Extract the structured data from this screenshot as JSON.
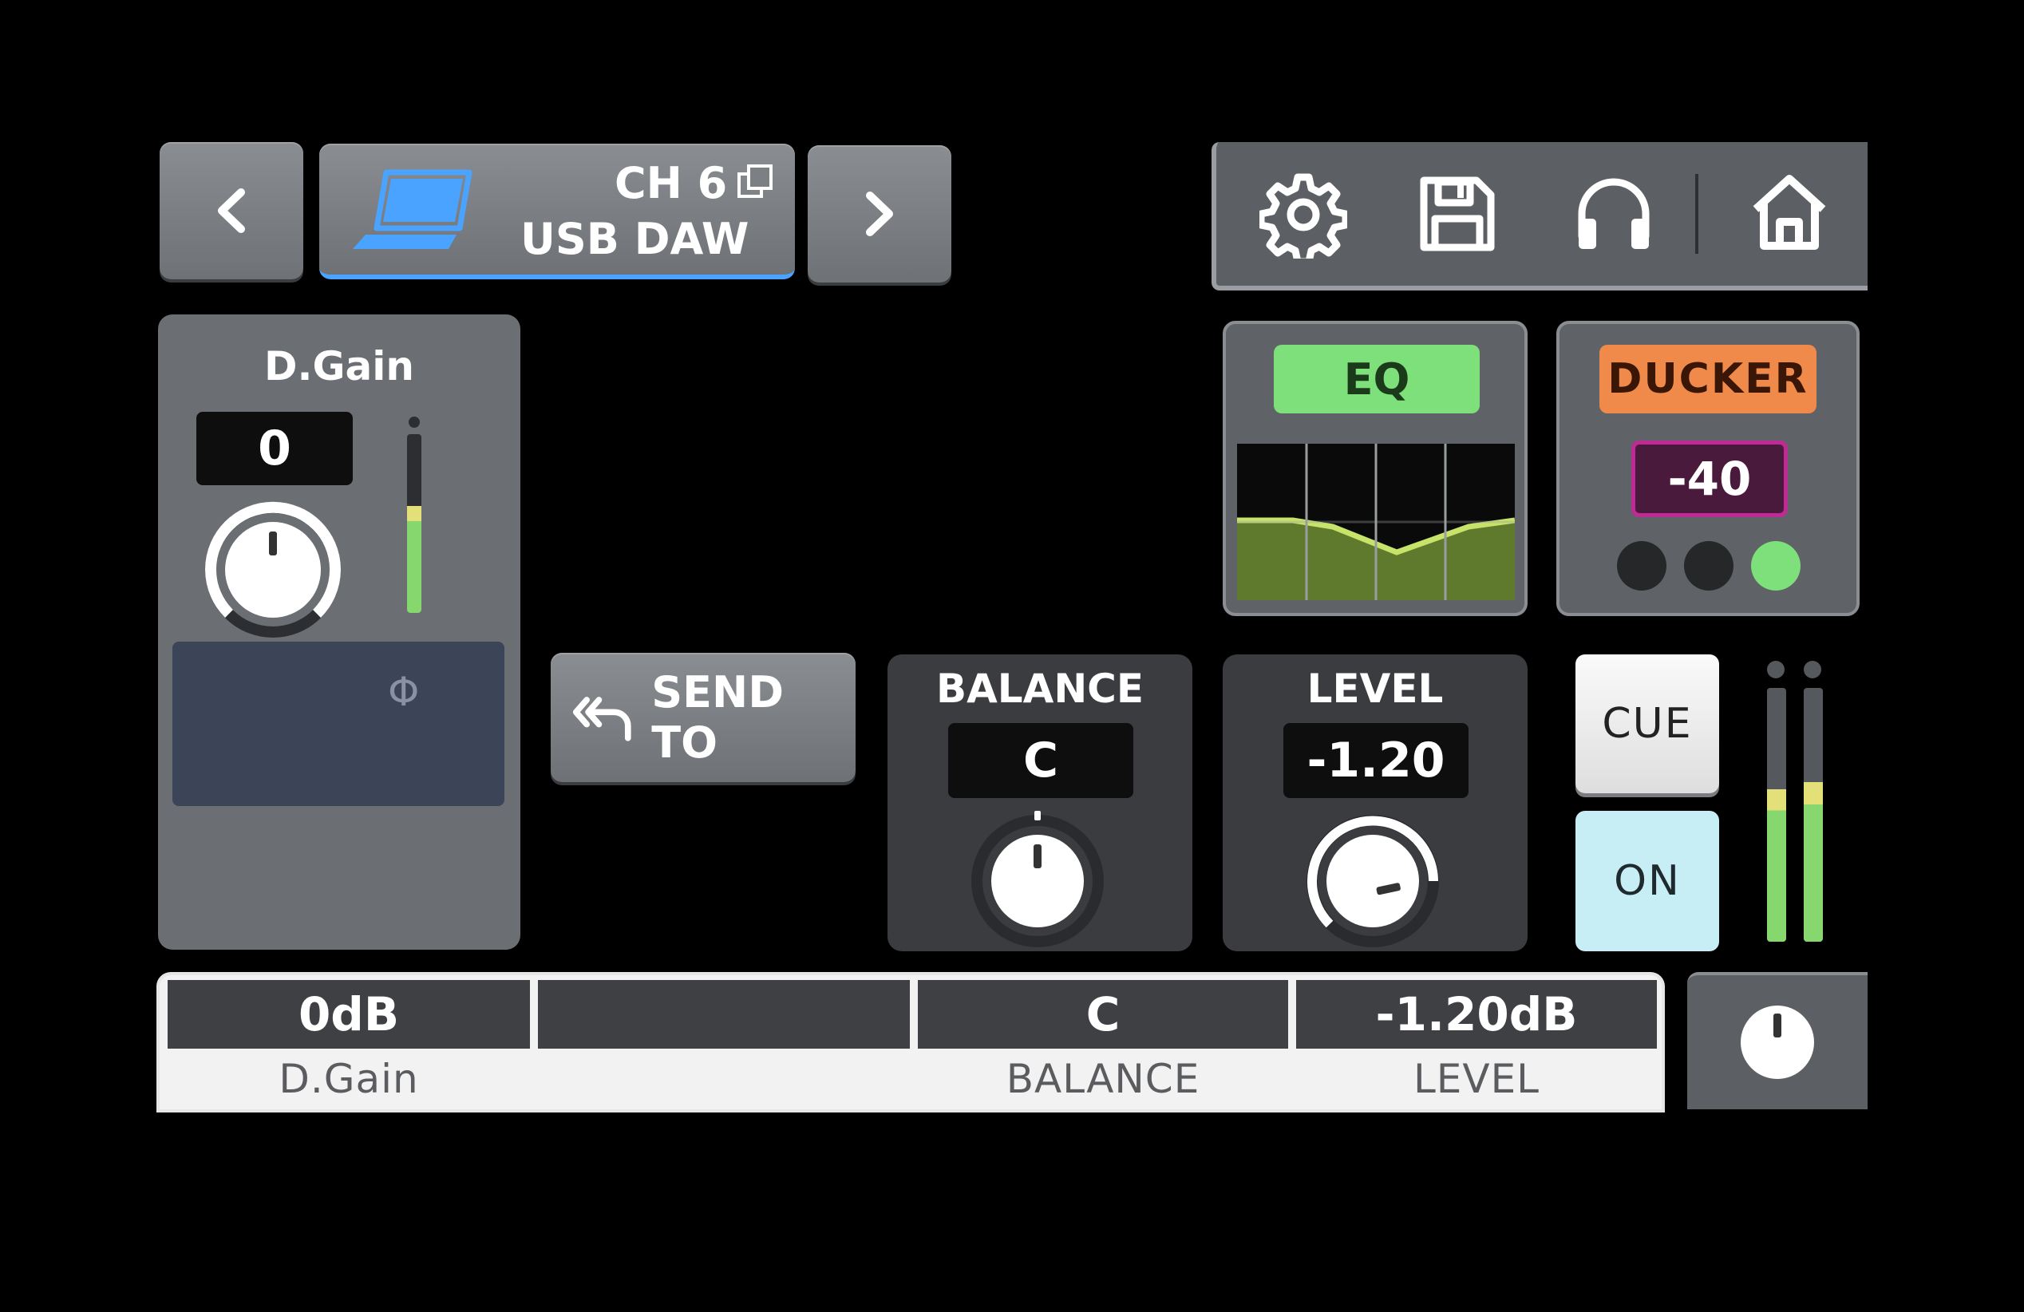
{
  "header": {
    "channel": "CH 6",
    "source": "USB DAW"
  },
  "dgain": {
    "title": "D.Gain",
    "value": "0",
    "phase_symbol": "Φ",
    "meter_level": 0.6
  },
  "eq": {
    "label": "EQ",
    "color": "#7ee07a"
  },
  "ducker": {
    "label": "DUCKER",
    "value": "-40",
    "color": "#f08a4b",
    "value_color": "#c02a94",
    "indicator_color": "#7ee07a"
  },
  "send_to": {
    "label": "SEND TO"
  },
  "balance": {
    "title": "BALANCE",
    "value": "C"
  },
  "level": {
    "title": "LEVEL",
    "value": "-1.20"
  },
  "cue": {
    "label": "CUE"
  },
  "on": {
    "label": "ON"
  },
  "meters": {
    "left_level": 0.6,
    "right_level": 0.63
  },
  "bottom_bar": {
    "cells": [
      {
        "value": "0dB",
        "label": "D.Gain"
      },
      {
        "value": "",
        "label": ""
      },
      {
        "value": "C",
        "label": "BALANCE"
      },
      {
        "value": "-1.20dB",
        "label": "LEVEL"
      }
    ]
  },
  "icons": [
    "chevron-left-icon",
    "laptop-icon",
    "copy-icon",
    "chevron-right-icon",
    "gear-icon",
    "floppy-disk-icon",
    "headphones-icon",
    "home-icon",
    "knob-icon"
  ]
}
